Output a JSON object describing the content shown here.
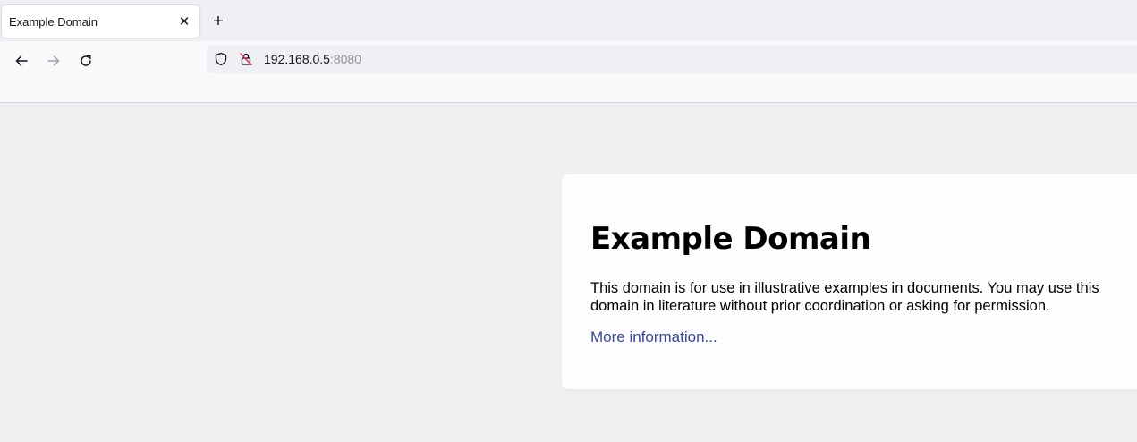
{
  "browser": {
    "tab": {
      "title": "Example Domain",
      "close_glyph": "✕"
    },
    "new_tab_glyph": "+",
    "nav": {
      "back_icon": "arrow-left-icon",
      "forward_icon": "arrow-right-icon",
      "reload_icon": "reload-icon"
    },
    "urlbar": {
      "host": "192.168.0.5",
      "port": ":8080",
      "shield_icon": "tracking-protection-shield-icon",
      "insecure_icon": "insecure-lock-icon"
    }
  },
  "page": {
    "heading": "Example Domain",
    "description": "This domain is for use in illustrative examples in documents. You may use this domain in literature without prior coordination or asking for permission.",
    "link_text": "More information...",
    "link_color": "#38488f"
  }
}
